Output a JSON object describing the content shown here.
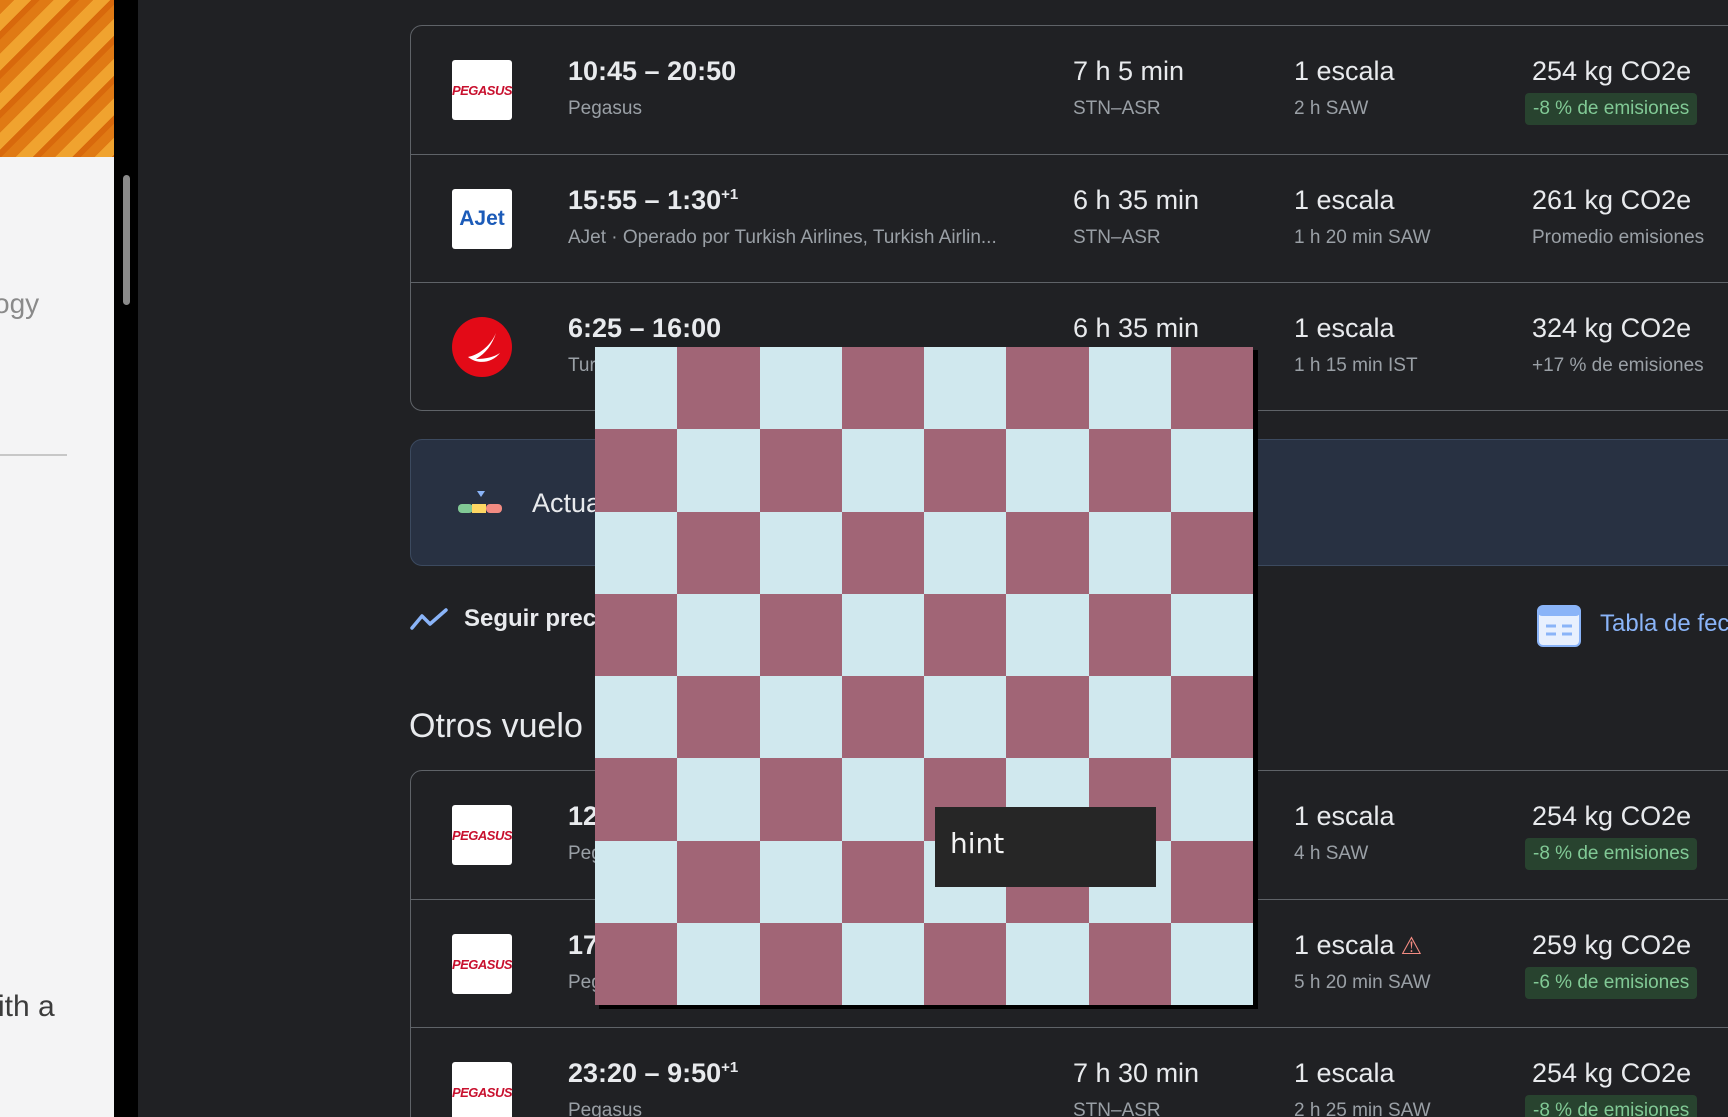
{
  "left_panel": {
    "text_top": "ogy",
    "text_bottom": "ith a"
  },
  "top_flights": [
    {
      "logo": "pegasus",
      "logo_text": "PEGASUS",
      "times": "10:45 – 20:50",
      "plus_day": "",
      "airline": "Pegasus",
      "duration": "7 h 5 min",
      "route": "STN–ASR",
      "stops": "1 escala",
      "layover": "2 h SAW",
      "co2": "254 kg CO2e",
      "emissions": "-8 % de emisiones",
      "emissions_style": "badge"
    },
    {
      "logo": "ajet",
      "logo_text": "AJet",
      "times": "15:55 – 1:30",
      "plus_day": "+1",
      "airline": "AJet · Operado por Turkish Airlines, Turkish Airlin...",
      "duration": "6 h 35 min",
      "route": "STN–ASR",
      "stops": "1 escala",
      "layover": "1 h 20 min SAW",
      "co2": "261 kg CO2e",
      "emissions": "Promedio emisiones",
      "emissions_style": "plain"
    },
    {
      "logo": "turkish",
      "logo_text": "",
      "times": "6:25 – 16:00",
      "plus_day": "",
      "airline": "Tur",
      "duration": "6 h 35 min",
      "route": "",
      "stops": "1 escala",
      "layover": "1 h 15 min IST",
      "co2": "324 kg CO2e",
      "emissions": "+17 % de emisiones",
      "emissions_style": "plain"
    }
  ],
  "banner": {
    "text": "Actua"
  },
  "track_prices": {
    "label": "Seguir prec"
  },
  "date_table": {
    "label": "Tabla de fec"
  },
  "other_flights_title": "Otros vuelo",
  "other_flights": [
    {
      "logo": "pegasus",
      "logo_text": "PEGASUS",
      "times": "12",
      "plus_day": "",
      "airline": "Peg",
      "stops": "1 escala",
      "layover": "4 h SAW",
      "co2": "254 kg CO2e",
      "emissions": "-8 % de emisiones",
      "warning": false
    },
    {
      "logo": "pegasus",
      "logo_text": "PEGASUS",
      "times": "17",
      "plus_day": "",
      "airline": "Peg",
      "stops": "1 escala",
      "layover": "5 h 20 min SAW",
      "co2": "259 kg CO2e",
      "emissions": "-6 % de emisiones",
      "warning": true
    },
    {
      "logo": "pegasus",
      "logo_text": "PEGASUS",
      "times": "23:20 – 9:50",
      "plus_day": "+1",
      "airline": "Pegasus",
      "duration": "7 h 30 min",
      "route": "STN–ASR",
      "stops": "1 escala",
      "layover": "2 h 25 min SAW",
      "co2": "254 kg CO2e",
      "emissions": "-8 % de emisiones",
      "warning": false
    }
  ],
  "game": {
    "board_size": 8,
    "hint_label": "hint",
    "colors": {
      "light": "#d0e8ee",
      "dark": "#a16576"
    }
  }
}
